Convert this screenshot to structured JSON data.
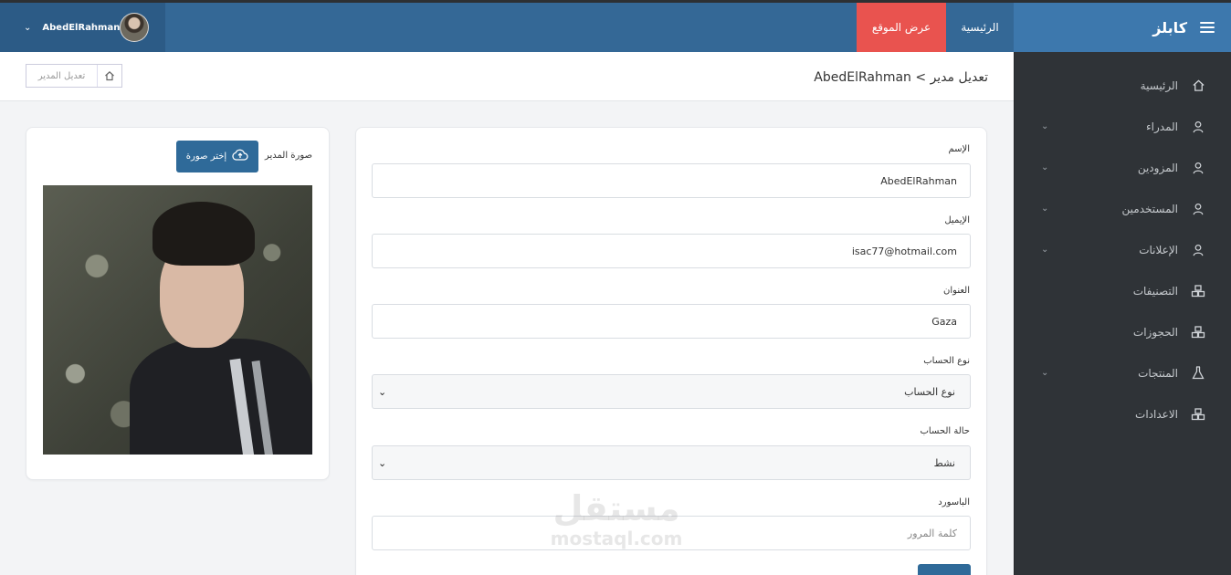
{
  "topbar": {
    "brand": "كابلز",
    "nav_home": "الرئيسية",
    "nav_view_site": "عرض الموقع",
    "user_name": "AbedElRahman"
  },
  "sidebar": {
    "items": [
      {
        "label": "الرئيسية",
        "icon": "home-icon",
        "has_chevron": false
      },
      {
        "label": "المدراء",
        "icon": "user-icon",
        "has_chevron": true
      },
      {
        "label": "المزودين",
        "icon": "user-icon",
        "has_chevron": true
      },
      {
        "label": "المستخدمين",
        "icon": "user-icon",
        "has_chevron": true
      },
      {
        "label": "الإعلانات",
        "icon": "user-icon",
        "has_chevron": true
      },
      {
        "label": "التصنيفات",
        "icon": "cubes-icon",
        "has_chevron": false
      },
      {
        "label": "الحجوزات",
        "icon": "cubes-icon",
        "has_chevron": false
      },
      {
        "label": "المنتجات",
        "icon": "flask-icon",
        "has_chevron": true
      },
      {
        "label": "الاعدادات",
        "icon": "cubes-icon",
        "has_chevron": false
      }
    ]
  },
  "header": {
    "title": "تعديل مدير > AbedElRahman",
    "breadcrumb_current": "تعديل المدير"
  },
  "form": {
    "name_label": "الإسم",
    "name_value": "AbedElRahman",
    "email_label": "الإيميل",
    "email_value": "isac77@hotmail.com",
    "address_label": "العنوان",
    "address_value": "Gaza",
    "account_type_label": "نوع الحساب",
    "account_type_selected": "نوع الحساب",
    "account_status_label": "حالة الحساب",
    "account_status_selected": "نشط",
    "password_label": "الباسورد",
    "password_placeholder": "كلمة المرور"
  },
  "image_card": {
    "label": "صورة المدير",
    "choose_button": "إختر صورة"
  },
  "watermark": {
    "arabic": "مستقل",
    "latin": "mostaql.com"
  },
  "colors": {
    "topbar": "#346896",
    "brand_bg": "#3d78ad",
    "view_site_bg": "#e9534f",
    "sidebar_bg": "#2f3337",
    "button_bg": "#2f6a99"
  }
}
